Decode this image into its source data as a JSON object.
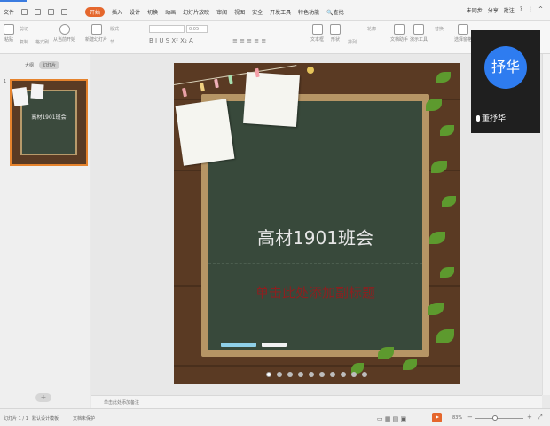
{
  "menu": {
    "file": "文件",
    "tabs": [
      "开始",
      "插入",
      "设计",
      "切换",
      "动画",
      "幻灯片放映",
      "审阅",
      "视图",
      "安全",
      "开发工具",
      "特色功能"
    ],
    "active_tab": "开始",
    "search": "查找"
  },
  "topright": {
    "sync": "未同步",
    "share": "分享",
    "comment": "批注"
  },
  "ribbon": {
    "paste": "粘贴",
    "cut": "剪切",
    "copy": "复制",
    "format_painter": "格式刷",
    "from_current": "从当前开始",
    "new_slide": "新建幻灯片",
    "layout": "版式",
    "section": "节",
    "font_size_placeholder": "0.05",
    "textbox": "文本框",
    "shape": "形状",
    "arrange": "排列",
    "outline": "轮廓",
    "doc_helper": "文档助手",
    "presenter_tools": "演示工具",
    "replace": "替换",
    "select_pane": "选择窗格"
  },
  "left_pane": {
    "tab_outline": "大纲",
    "tab_slides": "幻灯片",
    "thumb_number": "1",
    "thumb_title": "高材1901班会",
    "add": "+"
  },
  "slide": {
    "title": "高材1901班会",
    "subtitle": "单击此处添加副标题",
    "dots_total": 10,
    "dots_current": 0
  },
  "notes": {
    "placeholder": "单击此处添加备注"
  },
  "status": {
    "slide_count": "幻灯片 1 / 1",
    "template": "默认设计模板",
    "protect": "文档未保护",
    "zoom": "83%"
  },
  "video": {
    "avatar_text": "抒华",
    "name": "董抒华"
  },
  "colors": {
    "accent": "#e5672d",
    "chalkboard": "#38493b",
    "subtitle": "#8b2020",
    "avatar": "#2e7cf0"
  }
}
